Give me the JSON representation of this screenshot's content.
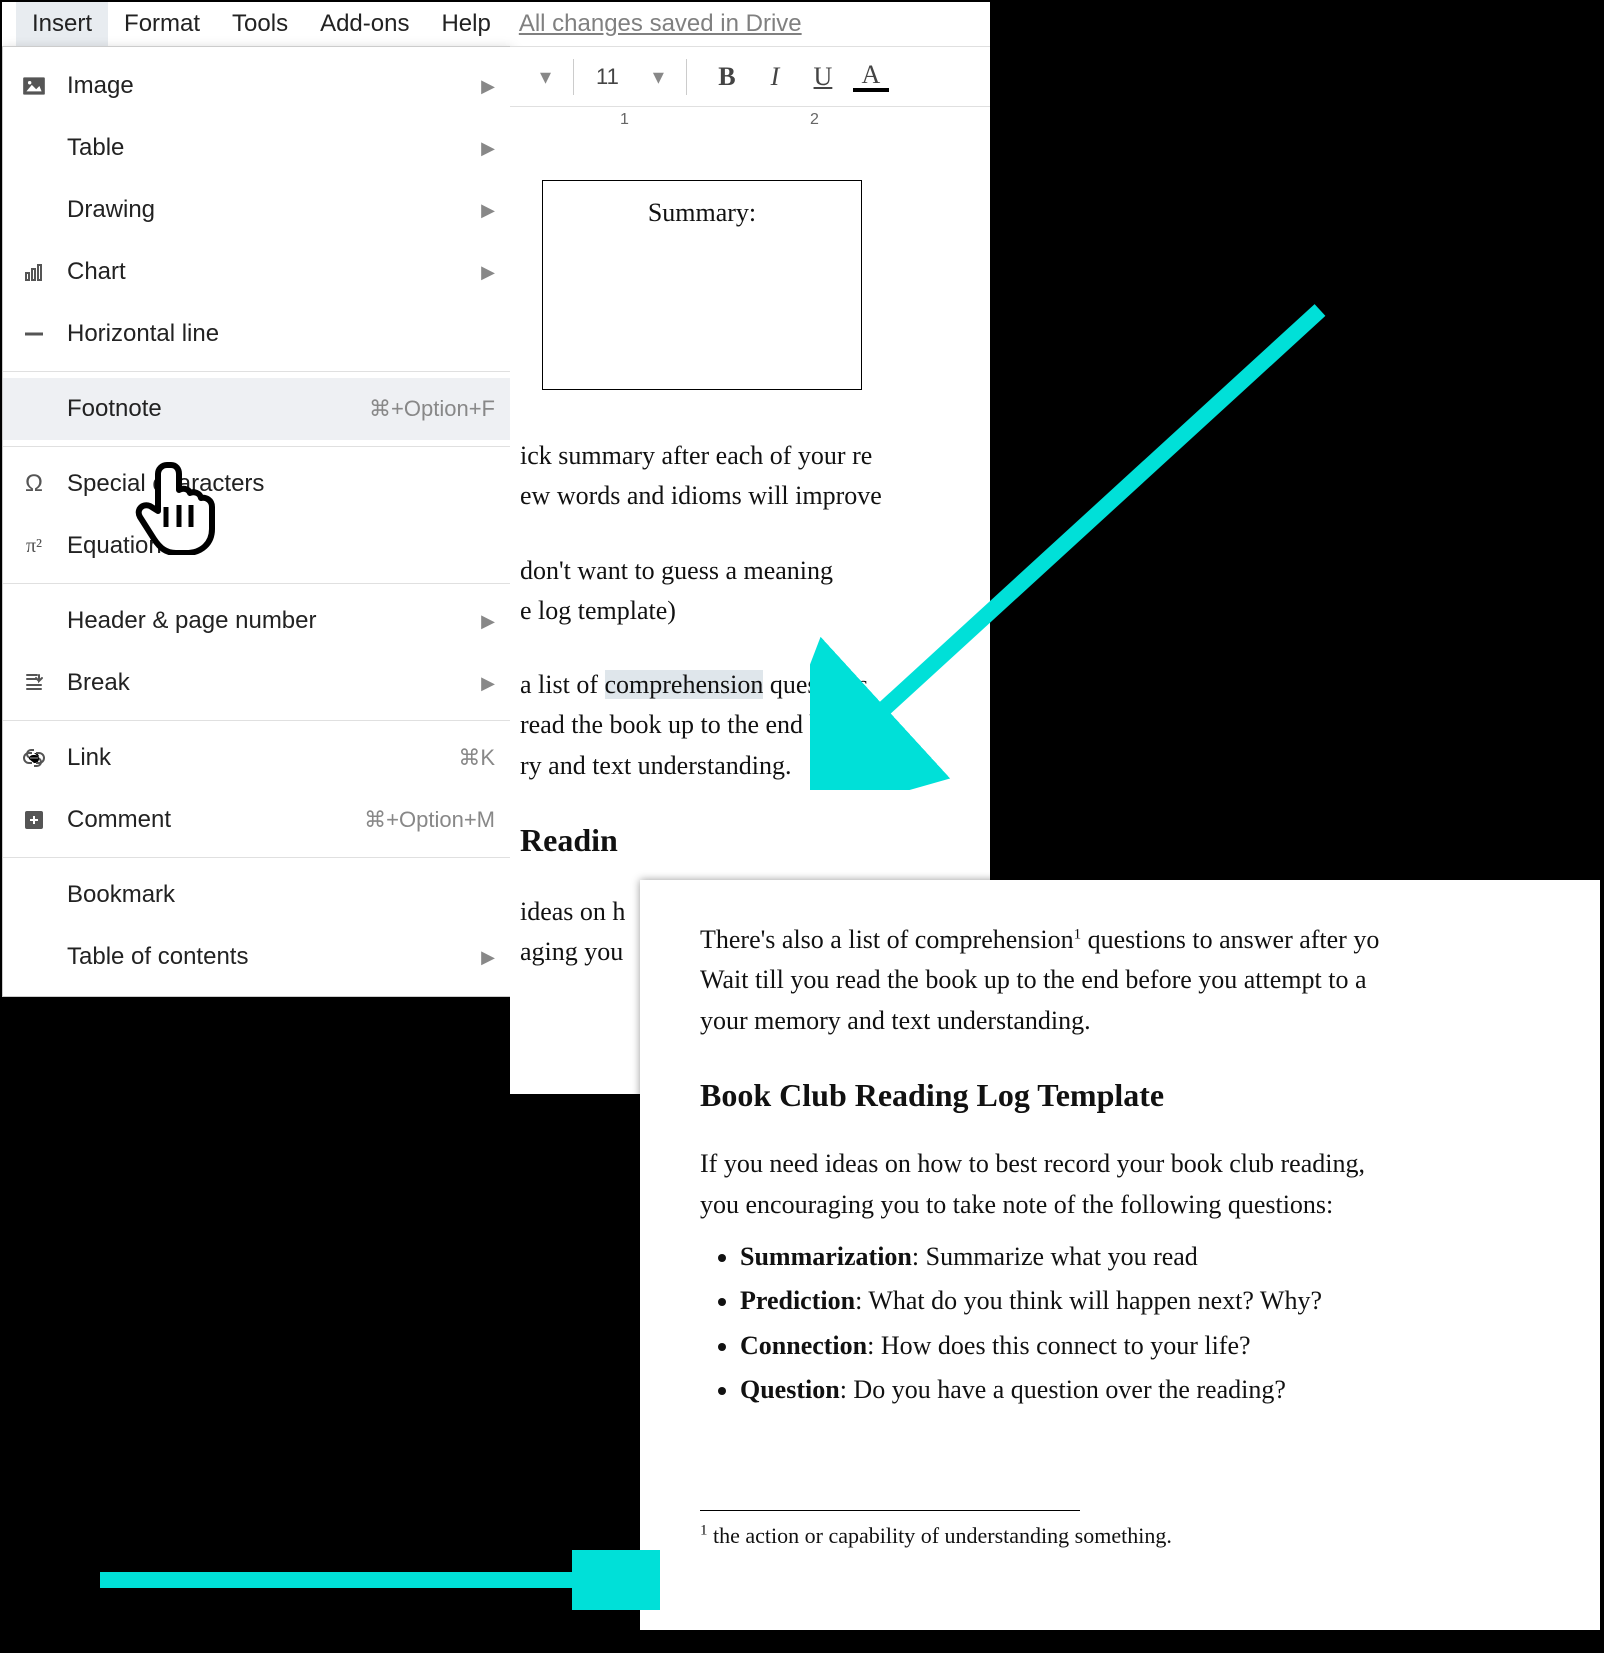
{
  "menubar": {
    "items": [
      "Insert",
      "Format",
      "Tools",
      "Add-ons",
      "Help"
    ],
    "active": 0,
    "saved_text": "All changes saved in Drive"
  },
  "dropdown": {
    "items": [
      {
        "icon": "image-icon",
        "label": "Image",
        "has_arrow": true
      },
      {
        "icon": "",
        "label": "Table",
        "has_arrow": true
      },
      {
        "icon": "",
        "label": "Drawing",
        "has_arrow": true
      },
      {
        "icon": "chart-icon",
        "label": "Chart",
        "has_arrow": true
      },
      {
        "icon": "hline-icon",
        "label": "Horizontal line"
      },
      {
        "sep": true
      },
      {
        "icon": "",
        "label": "Footnote",
        "shortcut": "⌘+Option+F",
        "highlight": true
      },
      {
        "sep": true
      },
      {
        "icon": "omega-icon",
        "label": "Special characters"
      },
      {
        "icon": "pi2-icon",
        "label": "Equation"
      },
      {
        "sep": true
      },
      {
        "icon": "",
        "label": "Header & page number",
        "has_arrow": true
      },
      {
        "icon": "break-icon",
        "label": "Break",
        "has_arrow": true
      },
      {
        "sep": true
      },
      {
        "icon": "link-icon",
        "label": "Link",
        "shortcut": "⌘K"
      },
      {
        "icon": "comment-icon",
        "label": "Comment",
        "shortcut": "⌘+Option+M"
      },
      {
        "sep": true
      },
      {
        "icon": "",
        "label": "Bookmark"
      },
      {
        "icon": "",
        "label": "Table of contents",
        "has_arrow": true
      }
    ]
  },
  "toolbar": {
    "font_size": "11",
    "bold": "B",
    "italic": "I",
    "underline": "U",
    "textcolor": "A"
  },
  "ruler": {
    "marks": [
      "1",
      "2"
    ]
  },
  "doc_top": {
    "cell_title": "Summary:",
    "para1_l1": "ick summary after each of your re",
    "para1_l2": "ew words and idioms will improve",
    "para2_l1": "don't want to guess a meaning",
    "para2_l2": "e log template)",
    "para3_prefix": " a list of ",
    "para3_highlight": "comprehension",
    "para3_suffix": " questions",
    "para3_l2": "read the book up to the end befo",
    "para3_l3": "ry and text understanding.",
    "heading_frag": " Readin",
    "para4_l1": "ideas on h",
    "para4_l2": "aging you"
  },
  "doc_page2": {
    "p1_l1a": "There's also a list of comprehension",
    "p1_l1b": " questions to answer after yo",
    "p1_l2": "Wait till you read the book up to the end before you attempt to a",
    "p1_l3": "your memory and text understanding.",
    "heading": "Book Club Reading Log Template",
    "p2_l1": "If you need ideas on how to best record your book club reading, ",
    "p2_l2": "you encouraging you to take note of the following questions:",
    "bullets": [
      {
        "b": "Summarization",
        "t": ": Summarize what you read"
      },
      {
        "b": "Prediction",
        "t": ": What do you think will happen next? Why?"
      },
      {
        "b": "Connection",
        "t": ": How does this connect to your life?"
      },
      {
        "b": "Question",
        "t": ": Do you have a question over the reading?"
      }
    ],
    "footnote_num": "1",
    "footnote_text": " the action or capability of understanding something."
  },
  "colors": {
    "arrow": "#00e0d8"
  }
}
